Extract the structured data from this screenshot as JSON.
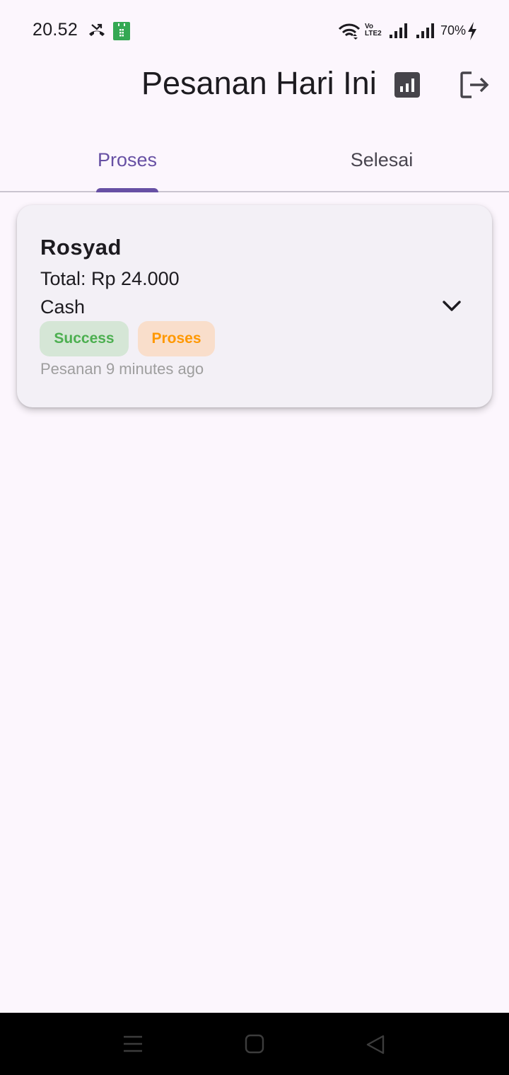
{
  "status_bar": {
    "time": "20.52",
    "volte_top": "Vo",
    "volte_bottom": "LTE2",
    "battery": "70%",
    "icons": [
      "missed-call-icon",
      "store-icon",
      "wifi-icon",
      "volte-icon",
      "signal-icon",
      "signal-icon",
      "charging-bolt-icon"
    ]
  },
  "app_bar": {
    "title": "Pesanan Hari Ini",
    "actions": [
      "bar-chart-icon",
      "logout-icon"
    ]
  },
  "tabs": [
    {
      "label": "Proses",
      "active": true
    },
    {
      "label": "Selesai",
      "active": false
    }
  ],
  "orders": [
    {
      "name": "Rosyad",
      "total": "Total: Rp 24.000",
      "payment": "Cash",
      "payment_status": "Success",
      "order_status": "Proses",
      "time": "Pesanan 9 minutes ago"
    }
  ],
  "colors": {
    "primary": "#6750a4",
    "background": "#fcf6fd",
    "card": "#f3f0f6",
    "success_text": "#4caf50",
    "success_bg": "#d5e6d6",
    "proses_text": "#ff9800",
    "proses_bg": "#f9decb"
  }
}
